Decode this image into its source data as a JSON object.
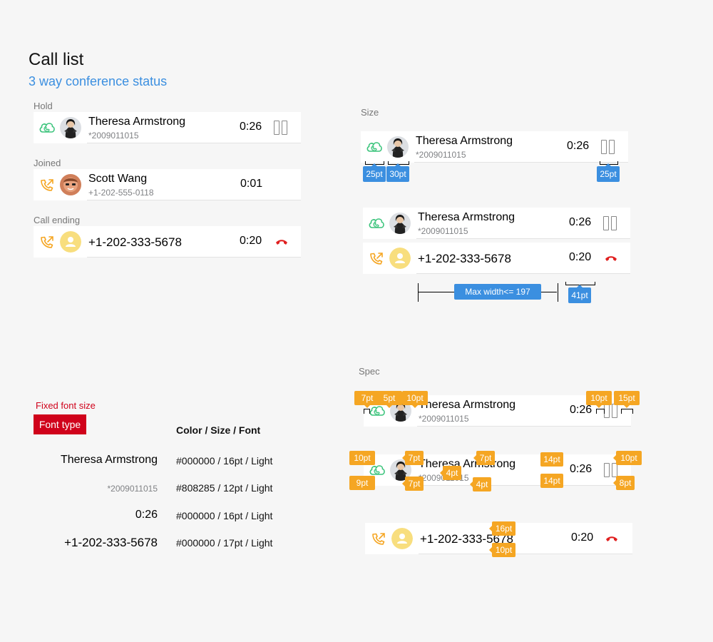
{
  "header": {
    "title": "Call list",
    "subtitle": "3 way conference status"
  },
  "sections": {
    "hold": "Hold",
    "joined": "Joined",
    "call_ending": "Call ending",
    "size": "Size",
    "spec": "Spec"
  },
  "calls": {
    "theresa": {
      "name": "Theresa Armstrong",
      "number": "*2009011015",
      "time": "0:26"
    },
    "scott": {
      "name": "Scott Wang",
      "number": "+1-202-555-0118",
      "time": "0:01"
    },
    "unknown": {
      "number": "+1-202-333-5678",
      "time": "0:20"
    }
  },
  "size_tags": {
    "icon_w": "25pt",
    "avatar_w": "30pt",
    "pause_w": "25pt",
    "max_width": "Max width<= 197",
    "time_w": "41pt"
  },
  "spec_tags": {
    "t7": "7pt",
    "t5": "5pt",
    "t10": "10pt",
    "t15": "15pt",
    "t9": "9pt",
    "t4": "4pt",
    "t14": "14pt",
    "t8": "8pt",
    "t16": "16pt"
  },
  "font_spec": {
    "fixed_label": "Fixed font size",
    "button": "Font type",
    "column_head": "Color / Size / Font",
    "rows": [
      {
        "sample": "Theresa Armstrong",
        "value": "#000000 / 16pt / Light"
      },
      {
        "sample": "*2009011015",
        "value": "#808285 / 12pt / Light"
      },
      {
        "sample": "0:26",
        "value": "#000000 / 16pt / Light"
      },
      {
        "sample": "+1-202-333-5678",
        "value": "#000000 / 17pt / Light"
      }
    ]
  },
  "colors": {
    "accent_blue": "#3b8fe0",
    "call_green": "#3cc47c",
    "call_orange": "#f5a623",
    "hangup_red": "#e02020",
    "font_type_red": "#d0021b"
  },
  "icons": {
    "hold": "cloud-phone-icon",
    "outgoing": "outgoing-call-icon",
    "pause": "pause-icon",
    "hangup": "hangup-icon",
    "contact": "contact-placeholder-icon"
  }
}
